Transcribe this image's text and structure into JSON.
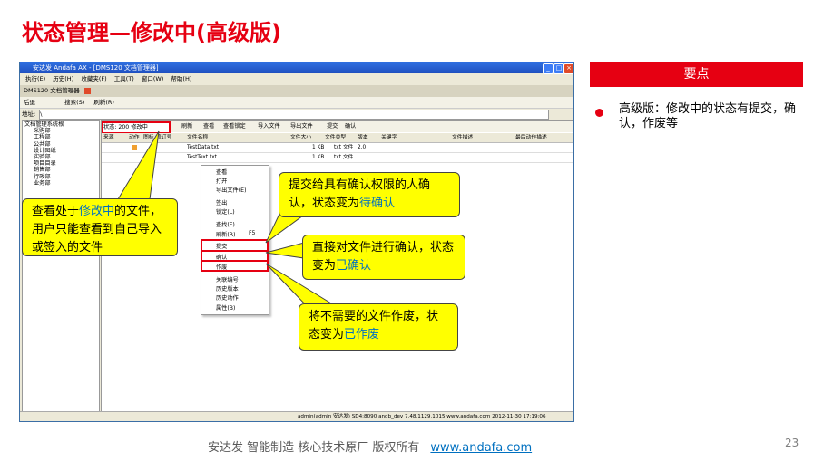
{
  "slide": {
    "title": "状态管理—修改中(高级版)",
    "panel_header": "要点",
    "bullet_text": "高级版：修改中的状态有提交，确认，作废等",
    "footer_text": "安达发   智能制造 核心技术原厂   版权所有",
    "footer_link": "www.andafa.com",
    "page_number": "23"
  },
  "app": {
    "window_title": "安达发 Andafa AX - [DMS120 文档管理器]",
    "menu": [
      "执行(E)",
      "历史(H)",
      "收藏夹(F)",
      "工具(T)",
      "窗口(W)",
      "帮助(H)"
    ],
    "doc_tab": "DMS120 文档管理器",
    "toolbar": [
      "后退",
      "搜索(S)",
      "刷新(R)"
    ],
    "address_label": "地址:",
    "address_value": "\\",
    "tree": [
      "文档管理系统根",
      "采购部",
      "工程部",
      "公共部",
      "设计图纸",
      "实验部",
      "项目目录",
      "销售部",
      "行政部",
      "业务部"
    ],
    "status_filter": "状态: 200 修改中",
    "grid_toolbar": [
      "刷新",
      "查看",
      "查看锁定",
      "导入文件",
      "导出文件",
      "提交",
      "确认"
    ],
    "columns": [
      "来源",
      "动作",
      "图标",
      "修订号",
      "文件名称",
      "文件大小",
      "文件类型",
      "版本",
      "关键字",
      "文件描述",
      "最后动作描述"
    ],
    "rows": [
      {
        "name": "TestData.txt",
        "size": "1 KB",
        "type": "txt 文件",
        "version": "2.0"
      },
      {
        "name": "TestText.txt",
        "size": "1 KB",
        "type": "txt 文件",
        "version": ""
      }
    ],
    "context_menu": [
      "查看",
      "打开",
      "导出文件(E)",
      "签出",
      "锁定(L)",
      "查找(F)",
      "刷新(R)",
      "提交",
      "确认",
      "作废",
      "关联编号",
      "历史版本",
      "历史动作",
      "属性(B)"
    ],
    "refresh_shortcut": "F5",
    "status_bar": "admin(admin 安达发)   SD4:8090   andb_dev   7.48.1129.1015   www.andafa.com   2012-11-30 17:19:06"
  },
  "callouts": {
    "c1_a": "查看处于",
    "c1_b": "修改中",
    "c1_c": "的文件，用户只能查看到自己导入或签入的文件",
    "c2_a": "提交给具有确认权限的人确认，状态变为",
    "c2_b": "待确认",
    "c3_a": "直接对文件进行确认，状态变为",
    "c3_b": "已确认",
    "c4_a": "将不需要的文件作废，状态变为",
    "c4_b": "已作废"
  },
  "colors": {
    "accent": "#e60012",
    "callout": "#ffff00",
    "link": "#0070c0"
  }
}
